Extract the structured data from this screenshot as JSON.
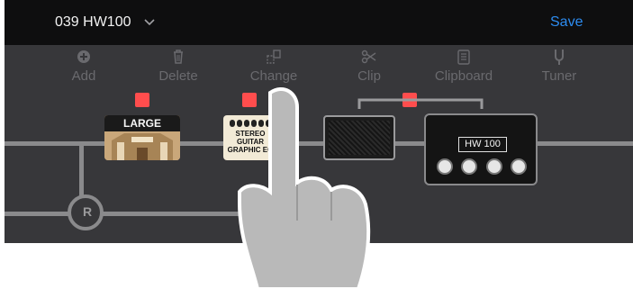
{
  "header": {
    "preset_name": "039 HW100",
    "save_label": "Save"
  },
  "toolbar": [
    {
      "label": "Add",
      "icon": "add-icon"
    },
    {
      "label": "Delete",
      "icon": "trash-icon"
    },
    {
      "label": "Change",
      "icon": "change-icon"
    },
    {
      "label": "Clip",
      "icon": "scissors-icon"
    },
    {
      "label": "Clipboard",
      "icon": "clipboard-icon"
    },
    {
      "label": "Tuner",
      "icon": "tuner-fork-icon"
    }
  ],
  "signal_chain": {
    "reverb": {
      "title": "LARGE CHAPEL"
    },
    "eq": {
      "title_lines": [
        "STEREO",
        "GUITAR",
        "GRAPHIC EQ"
      ]
    },
    "amp": {
      "model_label": "HW 100"
    },
    "return_label": "R"
  },
  "colors": {
    "accent": "#2d8cf0",
    "selected": "#ff4d4d",
    "background": "#37373a",
    "topbar": "#0e0e0f"
  }
}
